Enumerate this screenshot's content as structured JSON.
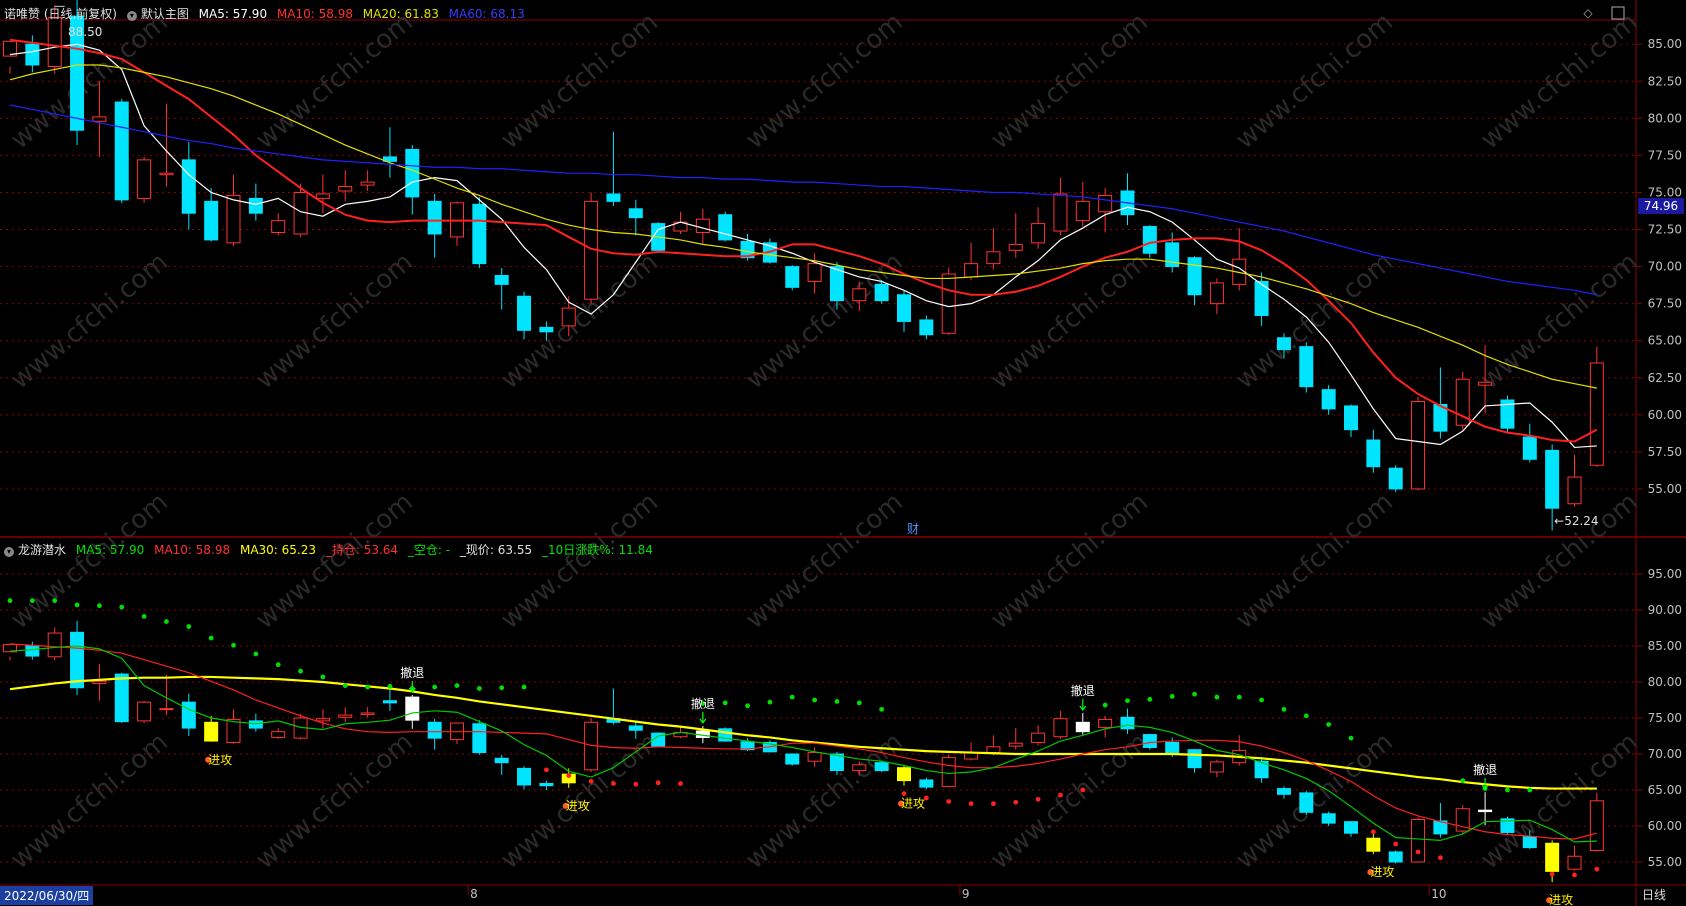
{
  "header_main": {
    "name": "诺唯赞 (日线,前复权)",
    "view": "默认主图",
    "ma5_label": "MA5: 57.90",
    "ma10_label": "MA10: 58.98",
    "ma20_label": "MA20: 61.83",
    "ma60_label": "MA60: 68.13"
  },
  "header_sub": {
    "name": "龙游潜水",
    "ma5_label": "MA5: 57.90",
    "ma10_label": "MA10: 58.98",
    "ma30_label": "MA30: 65.23",
    "hold_label": "_持仓: 53.64",
    "empty_label": "_空仓: -",
    "price_label": "_现价: 63.55",
    "chg_label": "_10日涨跌%: 11.84"
  },
  "footer": {
    "start_date": "2022/06/30/四",
    "period": "日线"
  },
  "colors": {
    "up": "#ff3232",
    "down": "#00e4ff",
    "ma5": "#ffffff",
    "ma10": "#ff2020",
    "ma20": "#e0e000",
    "ma60": "#2020ff",
    "grid": "#8b0000",
    "axis_text": "#c0c0c0",
    "sub_ma30": "#ffff00",
    "sub_ma10": "#ff2020",
    "sub_ma5": "#00c800",
    "dot_red": "#ff2020",
    "dot_green": "#00e000"
  },
  "chart_data": [
    {
      "type": "candlestick",
      "title": "诺唯赞 (日线,前复权)",
      "ylim": [
        52.5,
        86.5
      ],
      "yticks": [
        55.0,
        57.5,
        60.0,
        62.5,
        65.0,
        67.5,
        70.0,
        72.5,
        75.0,
        77.5,
        80.0,
        82.5,
        85.0
      ],
      "price_marker": "74.96",
      "high_annotation": "88.50",
      "low_annotation": "52.24",
      "x_month_labels": [
        {
          "i": 21,
          "label": "8"
        },
        {
          "i": 43,
          "label": "9"
        },
        {
          "i": 64,
          "label": "10"
        }
      ],
      "finance_marker": "财",
      "candles": [
        [
          84.2,
          85.2,
          83.5,
          83.0
        ],
        [
          85.0,
          83.6,
          85.6,
          83.1
        ],
        [
          83.5,
          86.8,
          87.6,
          83.0
        ],
        [
          86.9,
          79.2,
          88.5,
          78.2
        ],
        [
          79.8,
          80.1,
          82.5,
          77.4
        ],
        [
          81.1,
          74.5,
          81.3,
          74.3
        ],
        [
          74.6,
          77.2,
          77.4,
          74.3
        ],
        [
          76.2,
          76.3,
          81.0,
          75.4
        ],
        [
          77.2,
          73.6,
          78.4,
          72.5
        ],
        [
          74.4,
          71.8,
          75.3,
          71.7
        ],
        [
          71.6,
          74.8,
          76.2,
          71.4
        ],
        [
          74.6,
          73.6,
          75.6,
          73.1
        ],
        [
          72.3,
          73.1,
          73.6,
          72.1
        ],
        [
          72.2,
          75.0,
          75.6,
          72.0
        ],
        [
          74.6,
          74.9,
          76.2,
          73.6
        ],
        [
          75.1,
          75.4,
          76.5,
          74.4
        ],
        [
          75.5,
          75.7,
          76.5,
          75.1
        ],
        [
          77.4,
          77.1,
          79.4,
          76.0
        ],
        [
          77.9,
          74.7,
          78.2,
          73.5
        ],
        [
          74.4,
          72.2,
          74.9,
          70.6
        ],
        [
          72.0,
          74.3,
          74.4,
          71.4
        ],
        [
          74.2,
          70.2,
          74.7,
          69.9
        ],
        [
          69.4,
          68.8,
          69.9,
          67.1
        ],
        [
          68.0,
          65.7,
          68.3,
          65.1
        ],
        [
          65.9,
          65.6,
          66.3,
          65.0
        ],
        [
          66.0,
          67.2,
          68.0,
          65.3
        ],
        [
          67.8,
          74.4,
          75.0,
          67.5
        ],
        [
          74.9,
          74.4,
          79.1,
          74.1
        ],
        [
          73.9,
          73.3,
          74.5,
          72.1
        ],
        [
          72.9,
          71.1,
          73.0,
          70.9
        ],
        [
          72.4,
          73.0,
          73.7,
          72.2
        ],
        [
          72.3,
          73.2,
          73.9,
          71.5
        ],
        [
          73.5,
          71.8,
          73.7,
          71.7
        ],
        [
          71.7,
          70.6,
          72.2,
          70.4
        ],
        [
          71.6,
          70.3,
          71.9,
          70.2
        ],
        [
          70.0,
          68.6,
          70.1,
          68.4
        ],
        [
          69.0,
          70.2,
          70.9,
          68.2
        ],
        [
          70.0,
          67.7,
          70.3,
          67.1
        ],
        [
          67.7,
          68.5,
          69.0,
          67.0
        ],
        [
          68.8,
          67.7,
          69.1,
          67.5
        ],
        [
          68.1,
          66.3,
          68.4,
          65.6
        ],
        [
          66.4,
          65.4,
          66.7,
          65.1
        ],
        [
          65.5,
          69.5,
          69.9,
          65.4
        ],
        [
          69.3,
          70.2,
          71.6,
          69.1
        ],
        [
          70.2,
          71.0,
          72.6,
          69.8
        ],
        [
          71.1,
          71.5,
          73.6,
          70.6
        ],
        [
          71.6,
          72.9,
          74.0,
          71.2
        ],
        [
          72.4,
          74.9,
          76.0,
          72.1
        ],
        [
          73.1,
          74.4,
          75.7,
          72.7
        ],
        [
          73.7,
          74.8,
          75.3,
          72.3
        ],
        [
          75.1,
          73.5,
          76.3,
          72.8
        ],
        [
          72.7,
          70.9,
          72.8,
          70.6
        ],
        [
          71.6,
          70.0,
          72.3,
          69.6
        ],
        [
          70.6,
          68.1,
          70.7,
          67.4
        ],
        [
          67.5,
          68.9,
          69.2,
          66.8
        ],
        [
          68.8,
          70.5,
          72.6,
          68.4
        ],
        [
          69.0,
          66.7,
          69.6,
          66.0
        ],
        [
          65.2,
          64.4,
          65.5,
          63.8
        ],
        [
          64.6,
          61.9,
          64.9,
          61.5
        ],
        [
          61.7,
          60.4,
          62.0,
          60.0
        ],
        [
          60.6,
          59.0,
          60.7,
          58.5
        ],
        [
          58.3,
          56.5,
          59.0,
          56.1
        ],
        [
          56.4,
          55.0,
          56.6,
          54.8
        ],
        [
          55.0,
          60.9,
          61.2,
          54.9
        ],
        [
          60.7,
          58.9,
          63.2,
          58.4
        ],
        [
          59.3,
          62.4,
          62.9,
          59.0
        ],
        [
          62.0,
          62.2,
          64.7,
          60.1
        ],
        [
          61.0,
          59.1,
          61.3,
          58.8
        ],
        [
          58.5,
          57.0,
          59.4,
          56.8
        ],
        [
          57.6,
          53.7,
          58.0,
          52.2
        ],
        [
          54.0,
          55.8,
          57.3,
          53.8
        ],
        [
          56.6,
          63.5,
          64.6,
          56.5
        ]
      ],
      "series": [
        {
          "name": "MA5",
          "values": [
            84.3,
            84.5,
            84.8,
            85.0,
            84.6,
            83.3,
            79.5,
            77.8,
            76.2,
            75.0,
            74.5,
            74.2,
            74.6,
            73.7,
            73.4,
            74.2,
            74.4,
            74.7,
            75.7,
            76.0,
            75.8,
            74.5,
            73.2,
            71.3,
            69.8,
            67.6,
            66.8,
            68.1,
            70.3,
            72.5,
            73.0,
            72.6,
            72.2,
            71.8,
            71.4,
            70.9,
            70.3,
            69.8,
            69.3,
            69.0,
            68.4,
            67.7,
            67.3,
            67.5,
            68.1,
            69.3,
            70.4,
            71.8,
            72.6,
            73.5,
            74.0,
            73.7,
            73.0,
            71.8,
            70.5,
            69.9,
            68.8,
            67.8,
            66.6,
            64.9,
            62.7,
            60.4,
            58.4,
            58.2,
            58.0,
            58.9,
            60.6,
            60.7,
            60.8,
            59.5,
            57.8,
            57.9
          ]
        },
        {
          "name": "MA10",
          "values": [
            85.3,
            85.1,
            84.9,
            84.7,
            84.4,
            84.0,
            83.1,
            82.2,
            81.3,
            80.1,
            78.9,
            77.5,
            76.4,
            75.3,
            74.3,
            73.5,
            73.1,
            73.0,
            73.1,
            73.1,
            73.1,
            73.1,
            73.0,
            72.9,
            72.8,
            72.0,
            71.2,
            70.9,
            70.8,
            71.0,
            70.9,
            70.8,
            70.7,
            70.7,
            71.0,
            71.5,
            71.5,
            71.1,
            70.7,
            70.2,
            69.5,
            68.9,
            68.4,
            68.1,
            68.1,
            68.3,
            68.7,
            69.3,
            70.0,
            70.6,
            71.0,
            71.6,
            71.8,
            71.9,
            71.9,
            71.7,
            71.1,
            70.2,
            69.1,
            67.7,
            66.2,
            64.2,
            62.5,
            61.4,
            60.6,
            59.9,
            59.2,
            58.8,
            58.6,
            58.3,
            58.2,
            59.0
          ]
        },
        {
          "name": "MA20",
          "values": [
            82.6,
            83.0,
            83.3,
            83.6,
            83.6,
            83.4,
            83.1,
            82.8,
            82.4,
            82.0,
            81.5,
            80.9,
            80.3,
            79.6,
            78.9,
            78.2,
            77.6,
            77.0,
            76.5,
            75.9,
            75.3,
            74.8,
            74.2,
            73.7,
            73.2,
            72.8,
            72.5,
            72.3,
            72.2,
            72.0,
            71.8,
            71.5,
            71.3,
            71.0,
            70.8,
            70.6,
            70.4,
            70.1,
            69.8,
            69.6,
            69.4,
            69.2,
            69.2,
            69.3,
            69.4,
            69.5,
            69.7,
            69.9,
            70.2,
            70.4,
            70.5,
            70.5,
            70.3,
            70.1,
            69.9,
            69.6,
            69.3,
            68.9,
            68.5,
            68.0,
            67.5,
            66.9,
            66.4,
            65.9,
            65.3,
            64.7,
            64.0,
            63.4,
            62.9,
            62.4,
            62.1,
            61.8
          ]
        },
        {
          "name": "MA60",
          "values": [
            80.9,
            80.6,
            80.3,
            80.0,
            79.7,
            79.4,
            79.1,
            78.8,
            78.5,
            78.3,
            78.0,
            77.8,
            77.6,
            77.4,
            77.2,
            77.1,
            77.0,
            76.9,
            76.8,
            76.7,
            76.7,
            76.6,
            76.6,
            76.5,
            76.4,
            76.3,
            76.3,
            76.2,
            76.2,
            76.1,
            76.0,
            76.0,
            75.9,
            75.9,
            75.8,
            75.7,
            75.7,
            75.6,
            75.5,
            75.4,
            75.4,
            75.3,
            75.2,
            75.1,
            75.0,
            75.0,
            74.9,
            74.8,
            74.7,
            74.5,
            74.3,
            74.1,
            73.9,
            73.6,
            73.3,
            73.0,
            72.7,
            72.4,
            72.0,
            71.6,
            71.2,
            70.8,
            70.5,
            70.2,
            69.9,
            69.6,
            69.3,
            69.0,
            68.8,
            68.6,
            68.4,
            68.1
          ]
        }
      ]
    },
    {
      "type": "candlestick",
      "title": "龙游潜水",
      "ylim": [
        52.5,
        97.5
      ],
      "yticks": [
        55.0,
        60.0,
        65.0,
        70.0,
        75.0,
        80.0,
        85.0,
        90.0,
        95.0
      ],
      "signals": [
        {
          "i": 9,
          "label": "进攻",
          "kind": "attack"
        },
        {
          "i": 18,
          "label": "撤退",
          "kind": "retreat"
        },
        {
          "i": 25,
          "label": "进攻",
          "kind": "attack"
        },
        {
          "i": 31,
          "label": "撤退",
          "kind": "retreat"
        },
        {
          "i": 40,
          "label": "进攻",
          "kind": "attack"
        },
        {
          "i": 48,
          "label": "撤退",
          "kind": "retreat"
        },
        {
          "i": 61,
          "label": "进攻",
          "kind": "attack"
        },
        {
          "i": 66,
          "label": "撤退",
          "kind": "retreat"
        },
        {
          "i": 69,
          "label": "进攻",
          "kind": "attack"
        }
      ],
      "series": [
        {
          "name": "MA30",
          "values": [
            79.0,
            79.4,
            79.8,
            80.1,
            80.3,
            80.5,
            80.6,
            80.6,
            80.7,
            80.7,
            80.6,
            80.5,
            80.4,
            80.2,
            80.0,
            79.7,
            79.4,
            79.1,
            78.7,
            78.2,
            77.8,
            77.3,
            76.9,
            76.5,
            76.1,
            75.7,
            75.3,
            74.9,
            74.5,
            74.1,
            73.8,
            73.4,
            73.0,
            72.6,
            72.3,
            71.9,
            71.6,
            71.3,
            71.0,
            70.8,
            70.6,
            70.4,
            70.3,
            70.2,
            70.1,
            70.0,
            70.0,
            70.0,
            70.0,
            70.0,
            70.0,
            70.0,
            70.0,
            69.9,
            69.8,
            69.6,
            69.4,
            69.1,
            68.8,
            68.4,
            68.0,
            67.6,
            67.2,
            66.8,
            66.5,
            66.1,
            65.8,
            65.5,
            65.3,
            65.2,
            65.2,
            65.2
          ]
        },
        {
          "name": "MA10",
          "values": [
            85.3,
            85.1,
            84.9,
            84.7,
            84.4,
            84.0,
            83.1,
            82.2,
            81.3,
            80.1,
            78.9,
            77.5,
            76.4,
            75.3,
            74.3,
            73.5,
            73.1,
            73.0,
            73.1,
            73.1,
            73.1,
            73.1,
            73.0,
            72.9,
            72.8,
            72.0,
            71.2,
            70.9,
            70.8,
            71.0,
            70.9,
            70.8,
            70.7,
            70.7,
            71.0,
            71.5,
            71.5,
            71.1,
            70.7,
            70.2,
            69.5,
            68.9,
            68.4,
            68.1,
            68.1,
            68.3,
            68.7,
            69.3,
            70.0,
            70.6,
            71.0,
            71.6,
            71.8,
            71.9,
            71.9,
            71.7,
            71.1,
            70.2,
            69.1,
            67.7,
            66.2,
            64.2,
            62.5,
            61.4,
            60.6,
            59.9,
            59.2,
            58.8,
            58.6,
            58.3,
            58.2,
            59.0
          ]
        },
        {
          "name": "MA5",
          "values": [
            84.3,
            84.5,
            84.8,
            85.0,
            84.6,
            83.3,
            79.5,
            77.8,
            76.2,
            75.0,
            74.5,
            74.2,
            74.6,
            73.7,
            73.4,
            74.2,
            74.4,
            74.7,
            75.7,
            76.0,
            75.8,
            74.5,
            73.2,
            71.3,
            69.8,
            67.6,
            66.8,
            68.1,
            70.3,
            72.5,
            73.0,
            72.6,
            72.2,
            71.8,
            71.4,
            70.9,
            70.3,
            69.8,
            69.3,
            69.0,
            68.4,
            67.7,
            67.3,
            67.5,
            68.1,
            69.3,
            70.4,
            71.8,
            72.6,
            73.5,
            74.0,
            73.7,
            73.0,
            71.8,
            70.5,
            69.9,
            68.8,
            67.8,
            66.6,
            64.9,
            62.7,
            60.4,
            58.4,
            58.2,
            58.0,
            58.9,
            60.6,
            60.7,
            60.8,
            59.5,
            57.8,
            57.9
          ]
        }
      ]
    }
  ]
}
